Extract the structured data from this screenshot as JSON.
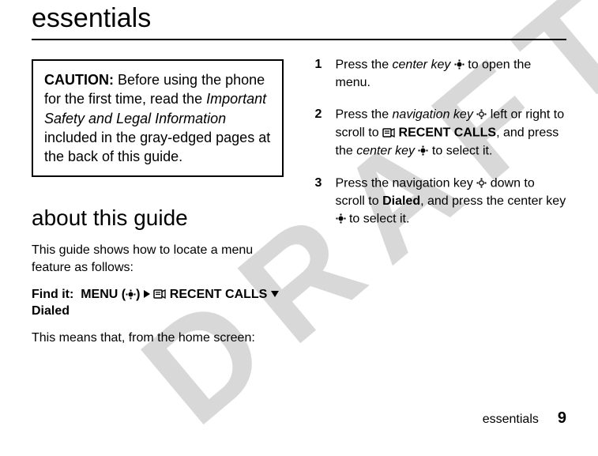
{
  "watermark": "DRAFT",
  "title": "essentials",
  "caution": {
    "lead": "CAUTION:",
    "part1": " Before using the phone for the first time, read the ",
    "ital": "Important Safety and Legal Information",
    "part2": " included in the gray-edged pages at the back of this guide."
  },
  "about_heading": "about this guide",
  "about_intro": "This guide shows how to locate a menu feature as follows:",
  "findit": {
    "label": "Find it:",
    "menu": "MENU",
    "paren_open": "(",
    "paren_close": ")",
    "recent": "RECENT CALLS",
    "dialed": "Dialed"
  },
  "about_followup": "This means that, from the home screen:",
  "steps": {
    "s1": {
      "num": "1",
      "a": "Press the ",
      "ital": "center key",
      "b": " to open the menu."
    },
    "s2": {
      "num": "2",
      "a": "Press the ",
      "ital": "navigation key",
      "b": " left or right to scroll to ",
      "recent": "RECENT CALLS",
      "c": ", and press the ",
      "ital2": "center key",
      "d": " to select it."
    },
    "s3": {
      "num": "3",
      "a": "Press the navigation key ",
      "b": " down to scroll to ",
      "dialed": "Dialed",
      "c": ", and press the center key ",
      "d": " to select it."
    }
  },
  "footer": {
    "section": "essentials",
    "page": "9"
  }
}
